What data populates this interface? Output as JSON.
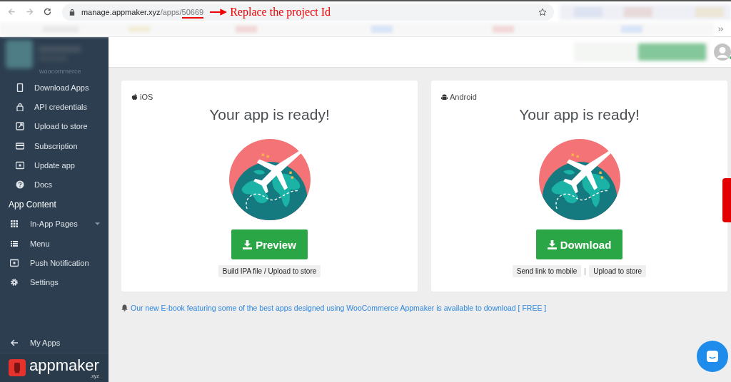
{
  "browser": {
    "url_host": "manage.appmaker.xyz",
    "url_path": "/apps/",
    "url_id": "50669"
  },
  "annotation": {
    "text": "Replace the project Id"
  },
  "sidebar": {
    "store_name": "woocommerce",
    "items": [
      {
        "label": "Download Apps"
      },
      {
        "label": "API credentials"
      },
      {
        "label": "Upload to store"
      },
      {
        "label": "Subscription"
      },
      {
        "label": "Update app"
      },
      {
        "label": "Docs"
      }
    ],
    "section_title": "App Content",
    "content_items": [
      {
        "label": "In-App Pages",
        "has_submenu": true
      },
      {
        "label": "Menu",
        "has_submenu": false
      },
      {
        "label": "Push Notification",
        "has_submenu": false
      },
      {
        "label": "Settings",
        "has_submenu": false
      }
    ],
    "footer_link": "My Apps",
    "logo": {
      "name": "appmaker",
      "suffix": ".xyz"
    }
  },
  "cards": [
    {
      "kind": "ios",
      "platform": "iOS",
      "title": "Your app is ready!",
      "button": "Preview",
      "links": [
        "Build IPA file / Upload to store"
      ]
    },
    {
      "kind": "android",
      "platform": "Android",
      "title": "Your app is ready!",
      "button": "Download",
      "links": [
        "Send link to mobile",
        "Upload to store"
      ]
    }
  ],
  "notice": "Our new E-book featuring some of the best apps designed using WooCommerce Appmaker is available to download [ FREE ]"
}
